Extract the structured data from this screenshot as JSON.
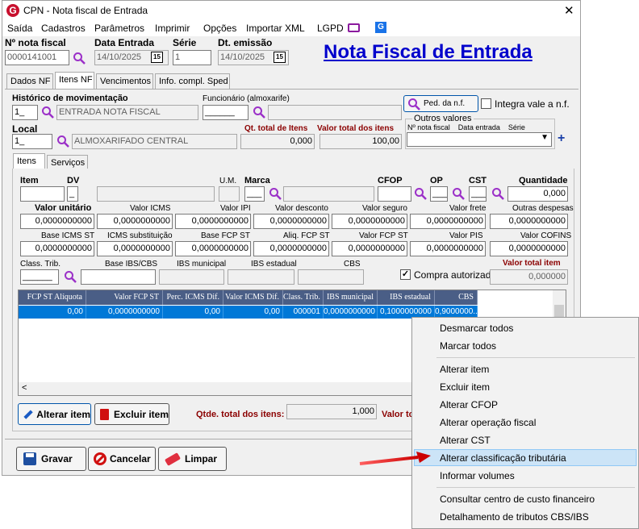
{
  "window": {
    "title": "CPN - Nota fiscal de Entrada",
    "close": "✕"
  },
  "menu": [
    "Saída",
    "Cadastros",
    "Parâmetros",
    "Imprimir",
    "Opções",
    "Importar XML",
    "LGPD"
  ],
  "header": {
    "nf_label": "Nº nota fiscal",
    "nf_value": "0000141001",
    "date_label": "Data Entrada",
    "date_value": "14/10/2025",
    "serie_label": "Série",
    "serie_value": "1",
    "emission_label": "Dt. emissão",
    "emission_value": "14/10/2025",
    "page_title": "Nota Fiscal de Entrada"
  },
  "main_tabs": [
    "Dados NF",
    "Itens NF",
    "Vencimentos",
    "Info. compl. Sped"
  ],
  "top": {
    "hist_label": "Histórico de movimentação",
    "hist_code": "1_",
    "hist_desc": "ENTRADA NOTA FISCAL",
    "func_label": "Funcionário (almoxarife)",
    "func_code": "______",
    "ped_button": "Ped. da n.f.",
    "integra_label": "Integra vale a n.f.",
    "local_label": "Local",
    "local_code": "1_",
    "local_desc": "ALMOXARIFADO CENTRAL",
    "qt_label": "Qt. total de Itens",
    "qt_value": "0,000",
    "vt_label": "Valor total dos itens",
    "vt_value": "100,00",
    "outros_label": "Outros valores",
    "outros_cols": "Nº nota fiscal    Data entrada    Série",
    "plus": "+"
  },
  "sub_tabs": [
    "Itens",
    "Serviços"
  ],
  "item": {
    "item_label": "Item",
    "dv_label": "DV",
    "um_label": "U.M.",
    "marca_label": "Marca",
    "cfop_label": "CFOP",
    "op_label": "OP",
    "cst_label": "CST",
    "qtd_label": "Quantidade",
    "qtd_value": "0,000",
    "marca_code": "___",
    "op_code": "___",
    "cst_code": "___"
  },
  "row1": [
    {
      "label": "Valor unitário",
      "value": "0,0000000000"
    },
    {
      "label": "Valor ICMS",
      "value": "0,0000000000"
    },
    {
      "label": "Valor IPI",
      "value": "0,0000000000"
    },
    {
      "label": "Valor desconto",
      "value": "0,0000000000"
    },
    {
      "label": "Valor seguro",
      "value": "0,0000000000"
    },
    {
      "label": "Valor frete",
      "value": "0,0000000000"
    },
    {
      "label": "Outras despesas",
      "value": "0,0000000000"
    }
  ],
  "row2": [
    {
      "label": "Base ICMS ST",
      "value": "0,0000000000"
    },
    {
      "label": "ICMS substituição",
      "value": "0,0000000000"
    },
    {
      "label": "Base FCP ST",
      "value": "0,0000000000"
    },
    {
      "label": "Aliq. FCP ST",
      "value": "0,0000000000"
    },
    {
      "label": "Valor FCP ST",
      "value": "0,0000000000"
    },
    {
      "label": "Valor PIS",
      "value": "0,0000000000"
    },
    {
      "label": "Valor COFINS",
      "value": "0,0000000000"
    }
  ],
  "row3": {
    "class_label": "Class. Trib.",
    "class_code": "______",
    "base_ibs_label": "Base IBS/CBS",
    "ibs_mun_label": "IBS municipal",
    "ibs_est_label": "IBS estadual",
    "cbs_label": "CBS",
    "compra_label": "Compra autorizada",
    "vti_label": "Valor total item",
    "vti_value": "0,000000"
  },
  "grid": {
    "headers": [
      "FCP ST Alíquota",
      "Valor FCP ST",
      "Perc. ICMS Dif.",
      "Valor ICMS Dif.",
      "Class. Trib.",
      "IBS municipal",
      "IBS estadual",
      "CBS"
    ],
    "row": [
      "0,00",
      "0,0000000000",
      "0,00",
      "0,00",
      "000001",
      "0,0000000000",
      "0,1000000000",
      "0,9000000..."
    ]
  },
  "bottom": {
    "alterar_item": "Alterar item",
    "excluir_item": "Excluir item",
    "qtde_label": "Qtde. total dos itens:",
    "qtde_value": "1,000",
    "valor_label": "Valor to"
  },
  "footer": {
    "gravar": "Gravar",
    "cancelar": "Cancelar",
    "limpar": "Limpar"
  },
  "context_menu": {
    "g1": [
      "Desmarcar todos",
      "Marcar todos"
    ],
    "g2": [
      "Alterar item",
      "Excluir item",
      "Alterar CFOP",
      "Alterar operação fiscal",
      "Alterar CST",
      "Alterar classificação tributária",
      "Informar volumes"
    ],
    "g3": [
      "Consultar centro de custo financeiro",
      "Detalhamento de tributos CBS/IBS"
    ]
  },
  "colors": {
    "accent": "#0078d7",
    "title_blue": "#0000cc",
    "grid_header": "#4a5e86",
    "dark_red": "#8b0000"
  }
}
